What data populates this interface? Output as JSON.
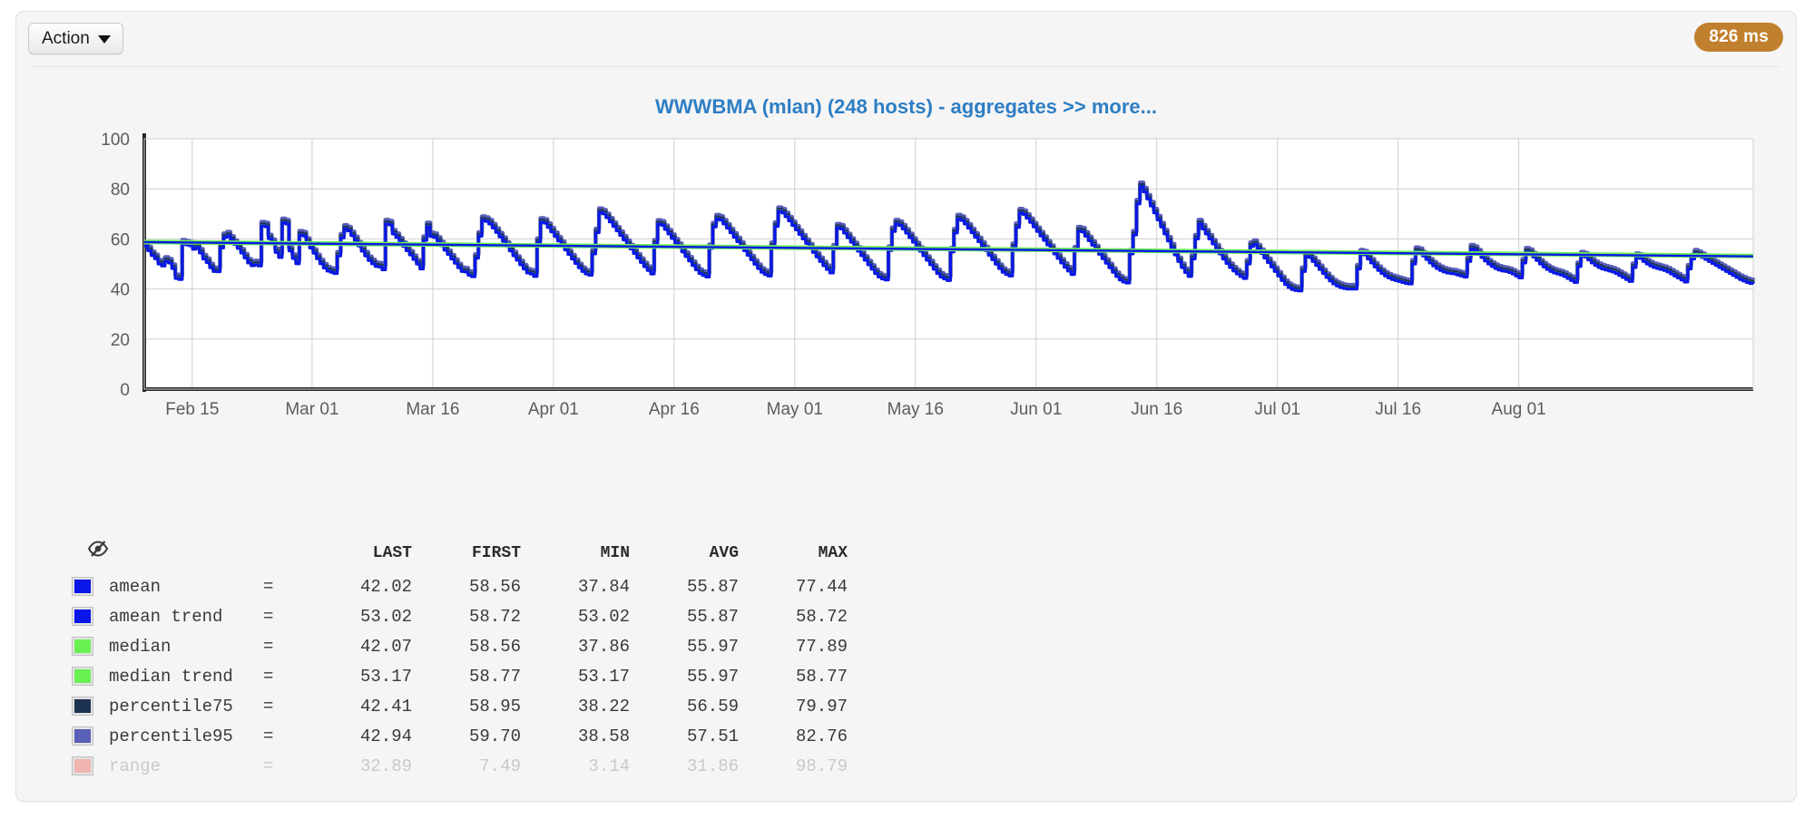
{
  "toolbar": {
    "action_label": "Action",
    "action_icon": "chevron-down-icon",
    "timing_badge": "826 ms",
    "timing_badge_color": "#c1802d"
  },
  "chart_title": "WWWBMA (mlan) (248 hosts) - aggregates >> more...",
  "legend": {
    "toggle_icon": "eye-slash-icon",
    "columns": [
      "LAST",
      "FIRST",
      "MIN",
      "AVG",
      "MAX"
    ],
    "rows": [
      {
        "name": "amean",
        "eq": "=",
        "color": "#0b16e8",
        "last": "42.02",
        "first": "58.56",
        "min": "37.84",
        "avg": "55.87",
        "max": "77.44",
        "enabled": true
      },
      {
        "name": "amean trend",
        "eq": "=",
        "color": "#0b16e8",
        "last": "53.02",
        "first": "58.72",
        "min": "53.02",
        "avg": "55.87",
        "max": "58.72",
        "enabled": true
      },
      {
        "name": "median",
        "eq": "=",
        "color": "#69f053",
        "last": "42.07",
        "first": "58.56",
        "min": "37.86",
        "avg": "55.97",
        "max": "77.89",
        "enabled": true
      },
      {
        "name": "median trend",
        "eq": "=",
        "color": "#69f053",
        "last": "53.17",
        "first": "58.77",
        "min": "53.17",
        "avg": "55.97",
        "max": "58.77",
        "enabled": true
      },
      {
        "name": "percentile75",
        "eq": "=",
        "color": "#1c3350",
        "last": "42.41",
        "first": "58.95",
        "min": "38.22",
        "avg": "56.59",
        "max": "79.97",
        "enabled": true
      },
      {
        "name": "percentile95",
        "eq": "=",
        "color": "#5a5fb8",
        "last": "42.94",
        "first": "59.70",
        "min": "38.58",
        "avg": "57.51",
        "max": "82.76",
        "enabled": true
      },
      {
        "name": "range",
        "eq": "=",
        "color": "#f0b5b0",
        "last": "32.89",
        "first": "7.49",
        "min": "3.14",
        "avg": "31.86",
        "max": "98.79",
        "enabled": false
      }
    ]
  },
  "chart_data": {
    "type": "line",
    "title": "WWWBMA (mlan) (248 hosts) - aggregates >> more...",
    "xlabel": "",
    "ylabel": "",
    "ylim": [
      0,
      100
    ],
    "yticks": [
      0,
      20,
      40,
      60,
      80,
      100
    ],
    "grid": true,
    "legend_position": "below",
    "x_tick_labels": [
      "Feb 15",
      "Mar 01",
      "Mar 16",
      "Apr 01",
      "Apr 16",
      "May 01",
      "May 16",
      "Jun 01",
      "Jun 16",
      "Jul 01",
      "Jul 16",
      "Aug 01"
    ],
    "x_tick_positions": [
      0.014,
      0.0885,
      0.1635,
      0.2385,
      0.3135,
      0.3885,
      0.4635,
      0.5385,
      0.6135,
      0.6885,
      0.7635,
      0.8385
    ],
    "series": [
      {
        "name": "amean",
        "color": "#0b16e8",
        "style": "step",
        "values": [
          57.1,
          55.3,
          53.4,
          52.1,
          50.0,
          49.2,
          51.1,
          50.4,
          48.2,
          44.2,
          43.8,
          58.0,
          57.6,
          57.3,
          55.9,
          56.6,
          54.4,
          52.0,
          50.6,
          48.5,
          47.0,
          46.9,
          56.4,
          60.6,
          61.2,
          59.5,
          57.8,
          56.2,
          54.4,
          52.4,
          50.4,
          49.3,
          49.7,
          49.2,
          65.2,
          64.9,
          60.1,
          58.2,
          54.6,
          52.6,
          66.5,
          66.0,
          55.2,
          52.2,
          50.1,
          61.6,
          61.2,
          58.7,
          56.4,
          54.3,
          52.1,
          50.1,
          48.4,
          47.2,
          46.7,
          46.2,
          53.2,
          60.4,
          63.9,
          63.2,
          61.3,
          59.3,
          57.2,
          55.1,
          53.2,
          51.4,
          50.1,
          49.0,
          48.8,
          47.7,
          66.0,
          65.6,
          62.0,
          60.6,
          58.8,
          57.0,
          55.3,
          53.6,
          51.8,
          50.0,
          48.0,
          59.4,
          64.9,
          61.0,
          60.6,
          59.1,
          57.3,
          55.5,
          53.8,
          52.0,
          50.3,
          48.5,
          47.0,
          46.8,
          45.5,
          44.9,
          52.3,
          61.1,
          67.4,
          67.0,
          66.0,
          64.4,
          62.6,
          60.8,
          59.0,
          57.1,
          55.2,
          53.3,
          51.5,
          49.7,
          48.0,
          46.4,
          46.0,
          45.0,
          58.6,
          66.7,
          66.3,
          64.6,
          62.8,
          61.0,
          59.2,
          57.4,
          55.6,
          53.8,
          52.0,
          50.2,
          48.5,
          47.0,
          46.0,
          45.5,
          54.0,
          62.5,
          70.6,
          70.0,
          68.5,
          66.8,
          65.0,
          63.2,
          61.4,
          59.6,
          57.8,
          56.0,
          54.2,
          52.4,
          50.6,
          48.9,
          47.4,
          46.0,
          58.0,
          65.9,
          65.5,
          63.8,
          62.0,
          60.2,
          58.4,
          56.6,
          54.8,
          53.0,
          51.2,
          49.4,
          47.7,
          46.2,
          45.4,
          44.8,
          56.2,
          64.8,
          68.0,
          67.5,
          66.0,
          64.3,
          62.5,
          60.7,
          58.9,
          57.1,
          55.3,
          53.5,
          51.7,
          49.9,
          48.2,
          46.7,
          45.8,
          45.2,
          57.0,
          65.0,
          71.0,
          70.4,
          68.9,
          67.2,
          65.4,
          63.6,
          61.8,
          60.0,
          58.2,
          56.4,
          54.6,
          52.8,
          51.0,
          49.3,
          47.8,
          46.4,
          56.0,
          64.4,
          64.0,
          62.3,
          60.5,
          58.7,
          56.9,
          55.1,
          53.3,
          51.5,
          49.7,
          47.9,
          46.2,
          44.8,
          44.0,
          43.6,
          55.4,
          63.0,
          66.0,
          65.4,
          64.0,
          62.3,
          60.5,
          58.7,
          56.9,
          55.1,
          53.3,
          51.5,
          49.7,
          47.9,
          46.2,
          44.8,
          44.0,
          43.4,
          54.8,
          62.4,
          68.0,
          67.4,
          66.0,
          64.3,
          62.5,
          60.7,
          58.9,
          57.1,
          55.3,
          53.5,
          51.7,
          49.9,
          48.2,
          46.7,
          45.8,
          45.2,
          56.6,
          64.6,
          70.4,
          69.8,
          68.3,
          66.6,
          64.8,
          63.0,
          61.2,
          59.4,
          57.6,
          55.8,
          54.0,
          52.2,
          50.4,
          48.7,
          47.2,
          45.8,
          55.2,
          63.2,
          62.8,
          61.1,
          59.3,
          57.5,
          55.7,
          53.9,
          52.1,
          50.3,
          48.5,
          46.7,
          45.0,
          43.6,
          42.8,
          42.4,
          54.0,
          61.6,
          74.0,
          80.9,
          78.8,
          76.0,
          73.2,
          70.4,
          67.6,
          64.8,
          62.0,
          59.2,
          56.4,
          53.6,
          51.0,
          48.6,
          46.6,
          45.0,
          52.0,
          60.0,
          66.0,
          64.0,
          62.0,
          60.0,
          58.0,
          56.0,
          54.0,
          52.0,
          50.2,
          48.6,
          47.2,
          46.0,
          45.0,
          44.2,
          50.0,
          57.0,
          57.8,
          56.0,
          54.2,
          52.4,
          50.6,
          48.8,
          47.0,
          45.2,
          43.4,
          41.8,
          40.6,
          39.8,
          39.4,
          39.2,
          47.0,
          53.0,
          52.6,
          51.0,
          49.4,
          47.8,
          46.2,
          44.6,
          43.2,
          42.0,
          41.2,
          40.6,
          40.2,
          40.0,
          40.0,
          40.0,
          48.0,
          54.0,
          53.6,
          52.0,
          50.4,
          48.8,
          47.4,
          46.2,
          45.2,
          44.4,
          43.8,
          43.4,
          43.0,
          42.6,
          42.2,
          42.0,
          50.0,
          55.0,
          54.6,
          53.2,
          51.8,
          50.4,
          49.2,
          48.2,
          47.4,
          46.8,
          46.4,
          46.2,
          46.0,
          45.6,
          45.2,
          44.8,
          51.0,
          56.0,
          55.4,
          54.0,
          52.6,
          51.2,
          50.0,
          49.0,
          48.2,
          47.6,
          47.2,
          47.0,
          46.6,
          46.0,
          45.2,
          44.4,
          50.4,
          54.8,
          54.2,
          52.8,
          51.4,
          50.0,
          48.8,
          47.8,
          47.0,
          46.4,
          46.0,
          45.6,
          45.0,
          44.2,
          43.4,
          42.6,
          49.0,
          53.2,
          52.8,
          51.6,
          50.4,
          49.4,
          48.6,
          48.0,
          47.6,
          47.2,
          46.8,
          46.2,
          45.4,
          44.6,
          43.8,
          43.0,
          48.6,
          52.6,
          52.2,
          51.0,
          50.0,
          49.2,
          48.6,
          48.2,
          47.8,
          47.4,
          46.8,
          46.0,
          45.2,
          44.4,
          43.6,
          42.8,
          48.0,
          52.0,
          54.0,
          53.4,
          52.6,
          51.8,
          51.0,
          50.2,
          49.4,
          48.6,
          47.8,
          47.0,
          46.2,
          45.4,
          44.6,
          43.8,
          43.2,
          42.6,
          42.2,
          42.02
        ]
      },
      {
        "name": "median",
        "color": "#69f053",
        "style": "step",
        "offset_from_amean": 0.05
      },
      {
        "name": "percentile75",
        "color": "#1c3350",
        "style": "step",
        "offset_from_amean": 0.7
      },
      {
        "name": "percentile95",
        "color": "#5a5fb8",
        "style": "step",
        "offset_from_amean": 1.6
      },
      {
        "name": "amean trend",
        "color": "#0b16e8",
        "style": "line",
        "trend_start": 58.72,
        "trend_end": 53.02
      },
      {
        "name": "median trend",
        "color": "#69f053",
        "style": "line",
        "trend_start": 58.77,
        "trend_end": 53.17
      }
    ]
  }
}
